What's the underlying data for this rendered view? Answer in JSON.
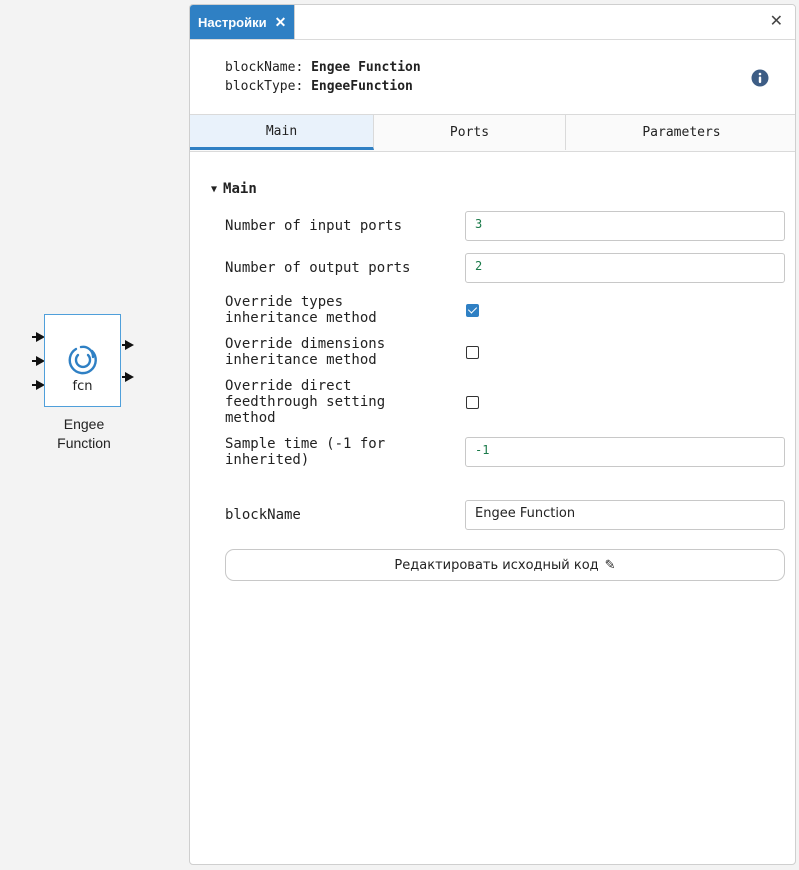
{
  "canvas": {
    "block": {
      "icon": "engee-logo-icon",
      "text": "fcn",
      "caption_line1": "Engee",
      "caption_line2": "Function",
      "input_ports": 3,
      "output_ports": 2,
      "border_color": "#4f9fda"
    }
  },
  "panel": {
    "tab_title": "Настройки",
    "tab_close_icon": "close-icon",
    "close_icon": "close-icon",
    "accent_color": "#2f80c4",
    "meta": {
      "block_name_key": "blockName:",
      "block_name_value": "Engee Function",
      "block_type_key": "blockType:",
      "block_type_value": "EngeeFunction"
    },
    "info_icon": "info-icon",
    "subtabs": [
      {
        "label": "Main",
        "active": true
      },
      {
        "label": "Ports",
        "active": false
      },
      {
        "label": "Parameters",
        "active": false
      }
    ],
    "section": {
      "title": "Main",
      "caret_icon": "caret-down-icon"
    },
    "fields": {
      "num_inputs_label": "Number of input ports",
      "num_inputs_value": "3",
      "num_outputs_label": "Number of output ports",
      "num_outputs_value": "2",
      "override_types_label_l1": "Override types",
      "override_types_label_l2": "inheritance method",
      "override_types_checked": true,
      "override_dims_label_l1": "Override dimensions",
      "override_dims_label_l2": "inheritance method",
      "override_dims_checked": false,
      "override_feed_label_l1": "Override direct",
      "override_feed_label_l2": "feedthrough setting",
      "override_feed_label_l3": "method",
      "override_feed_checked": false,
      "sample_time_label_l1": "Sample time (-1 for",
      "sample_time_label_l2": "inherited)",
      "sample_time_value": "-1",
      "block_name_label": "blockName",
      "block_name_value": "Engee Function"
    },
    "edit_button": {
      "label": "Редактировать исходный код",
      "icon": "pencil-icon"
    }
  }
}
